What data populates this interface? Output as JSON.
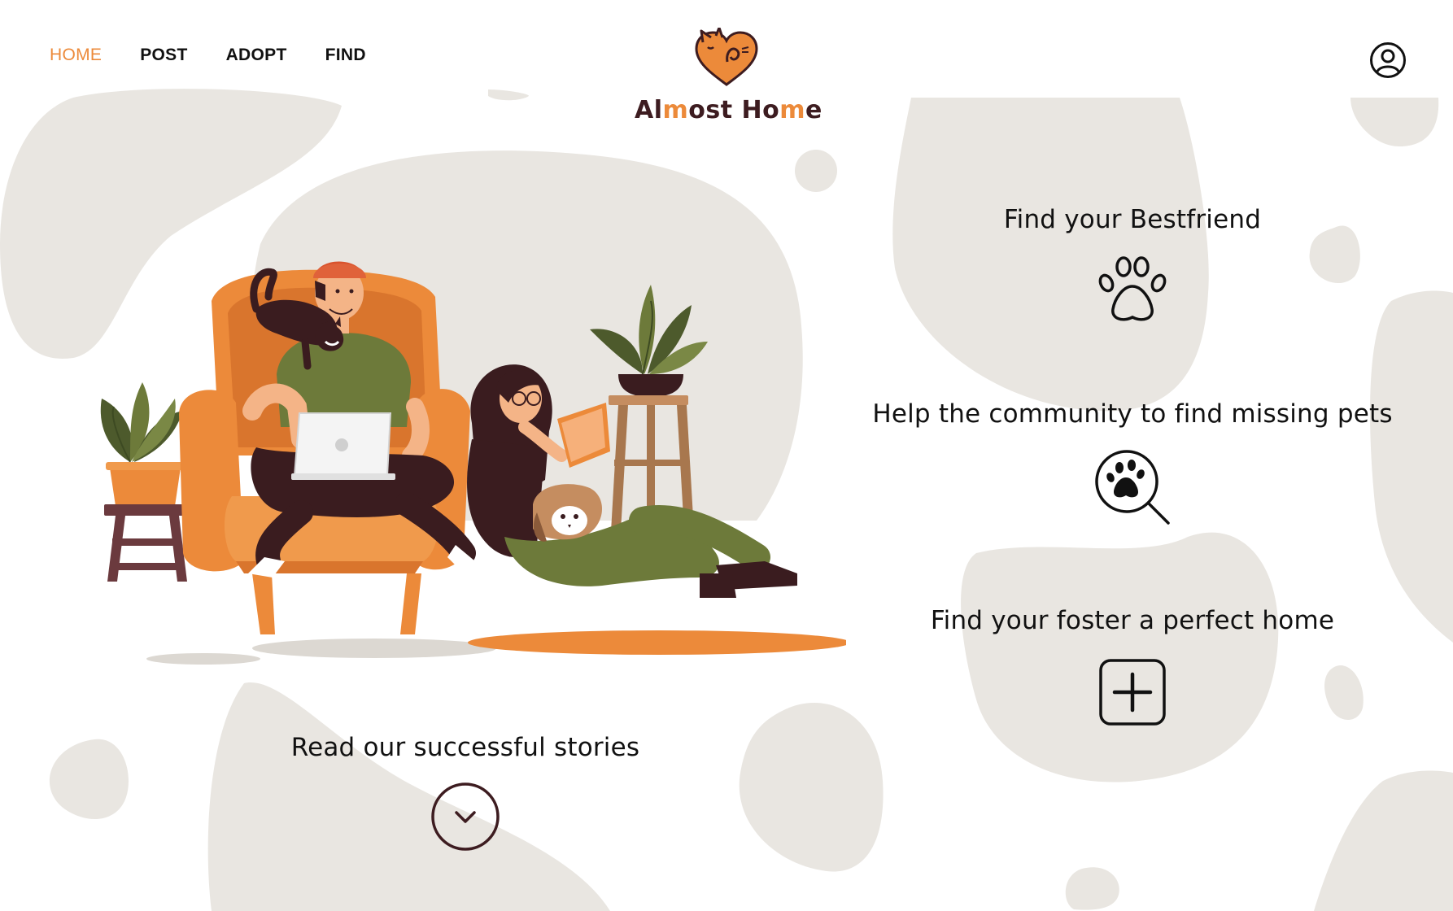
{
  "nav": {
    "items": [
      {
        "label": "HOME",
        "active": true
      },
      {
        "label": "POST",
        "active": false
      },
      {
        "label": "ADOPT",
        "active": false
      },
      {
        "label": "FIND",
        "active": false
      }
    ]
  },
  "brand": {
    "name_parts": [
      "Al",
      "m",
      "ost Ho",
      "m",
      "e"
    ],
    "logo_icon": "heart-cat-icon"
  },
  "profile": {
    "icon": "user-circle-icon"
  },
  "features": [
    {
      "label": "Find your Bestfriend",
      "icon": "paw-icon"
    },
    {
      "label": "Help the community to find missing pets",
      "icon": "paw-magnifier-icon"
    },
    {
      "label": "Find your foster a perfect home",
      "icon": "plus-square-icon"
    }
  ],
  "stories": {
    "label": "Read our successful stories",
    "icon": "chevron-down-circle-icon"
  },
  "colors": {
    "accent": "#ec8a3a",
    "brand_dark": "#3d1c20",
    "blob": "#e9e6e1",
    "text": "#111111",
    "background": "#ffffff"
  }
}
